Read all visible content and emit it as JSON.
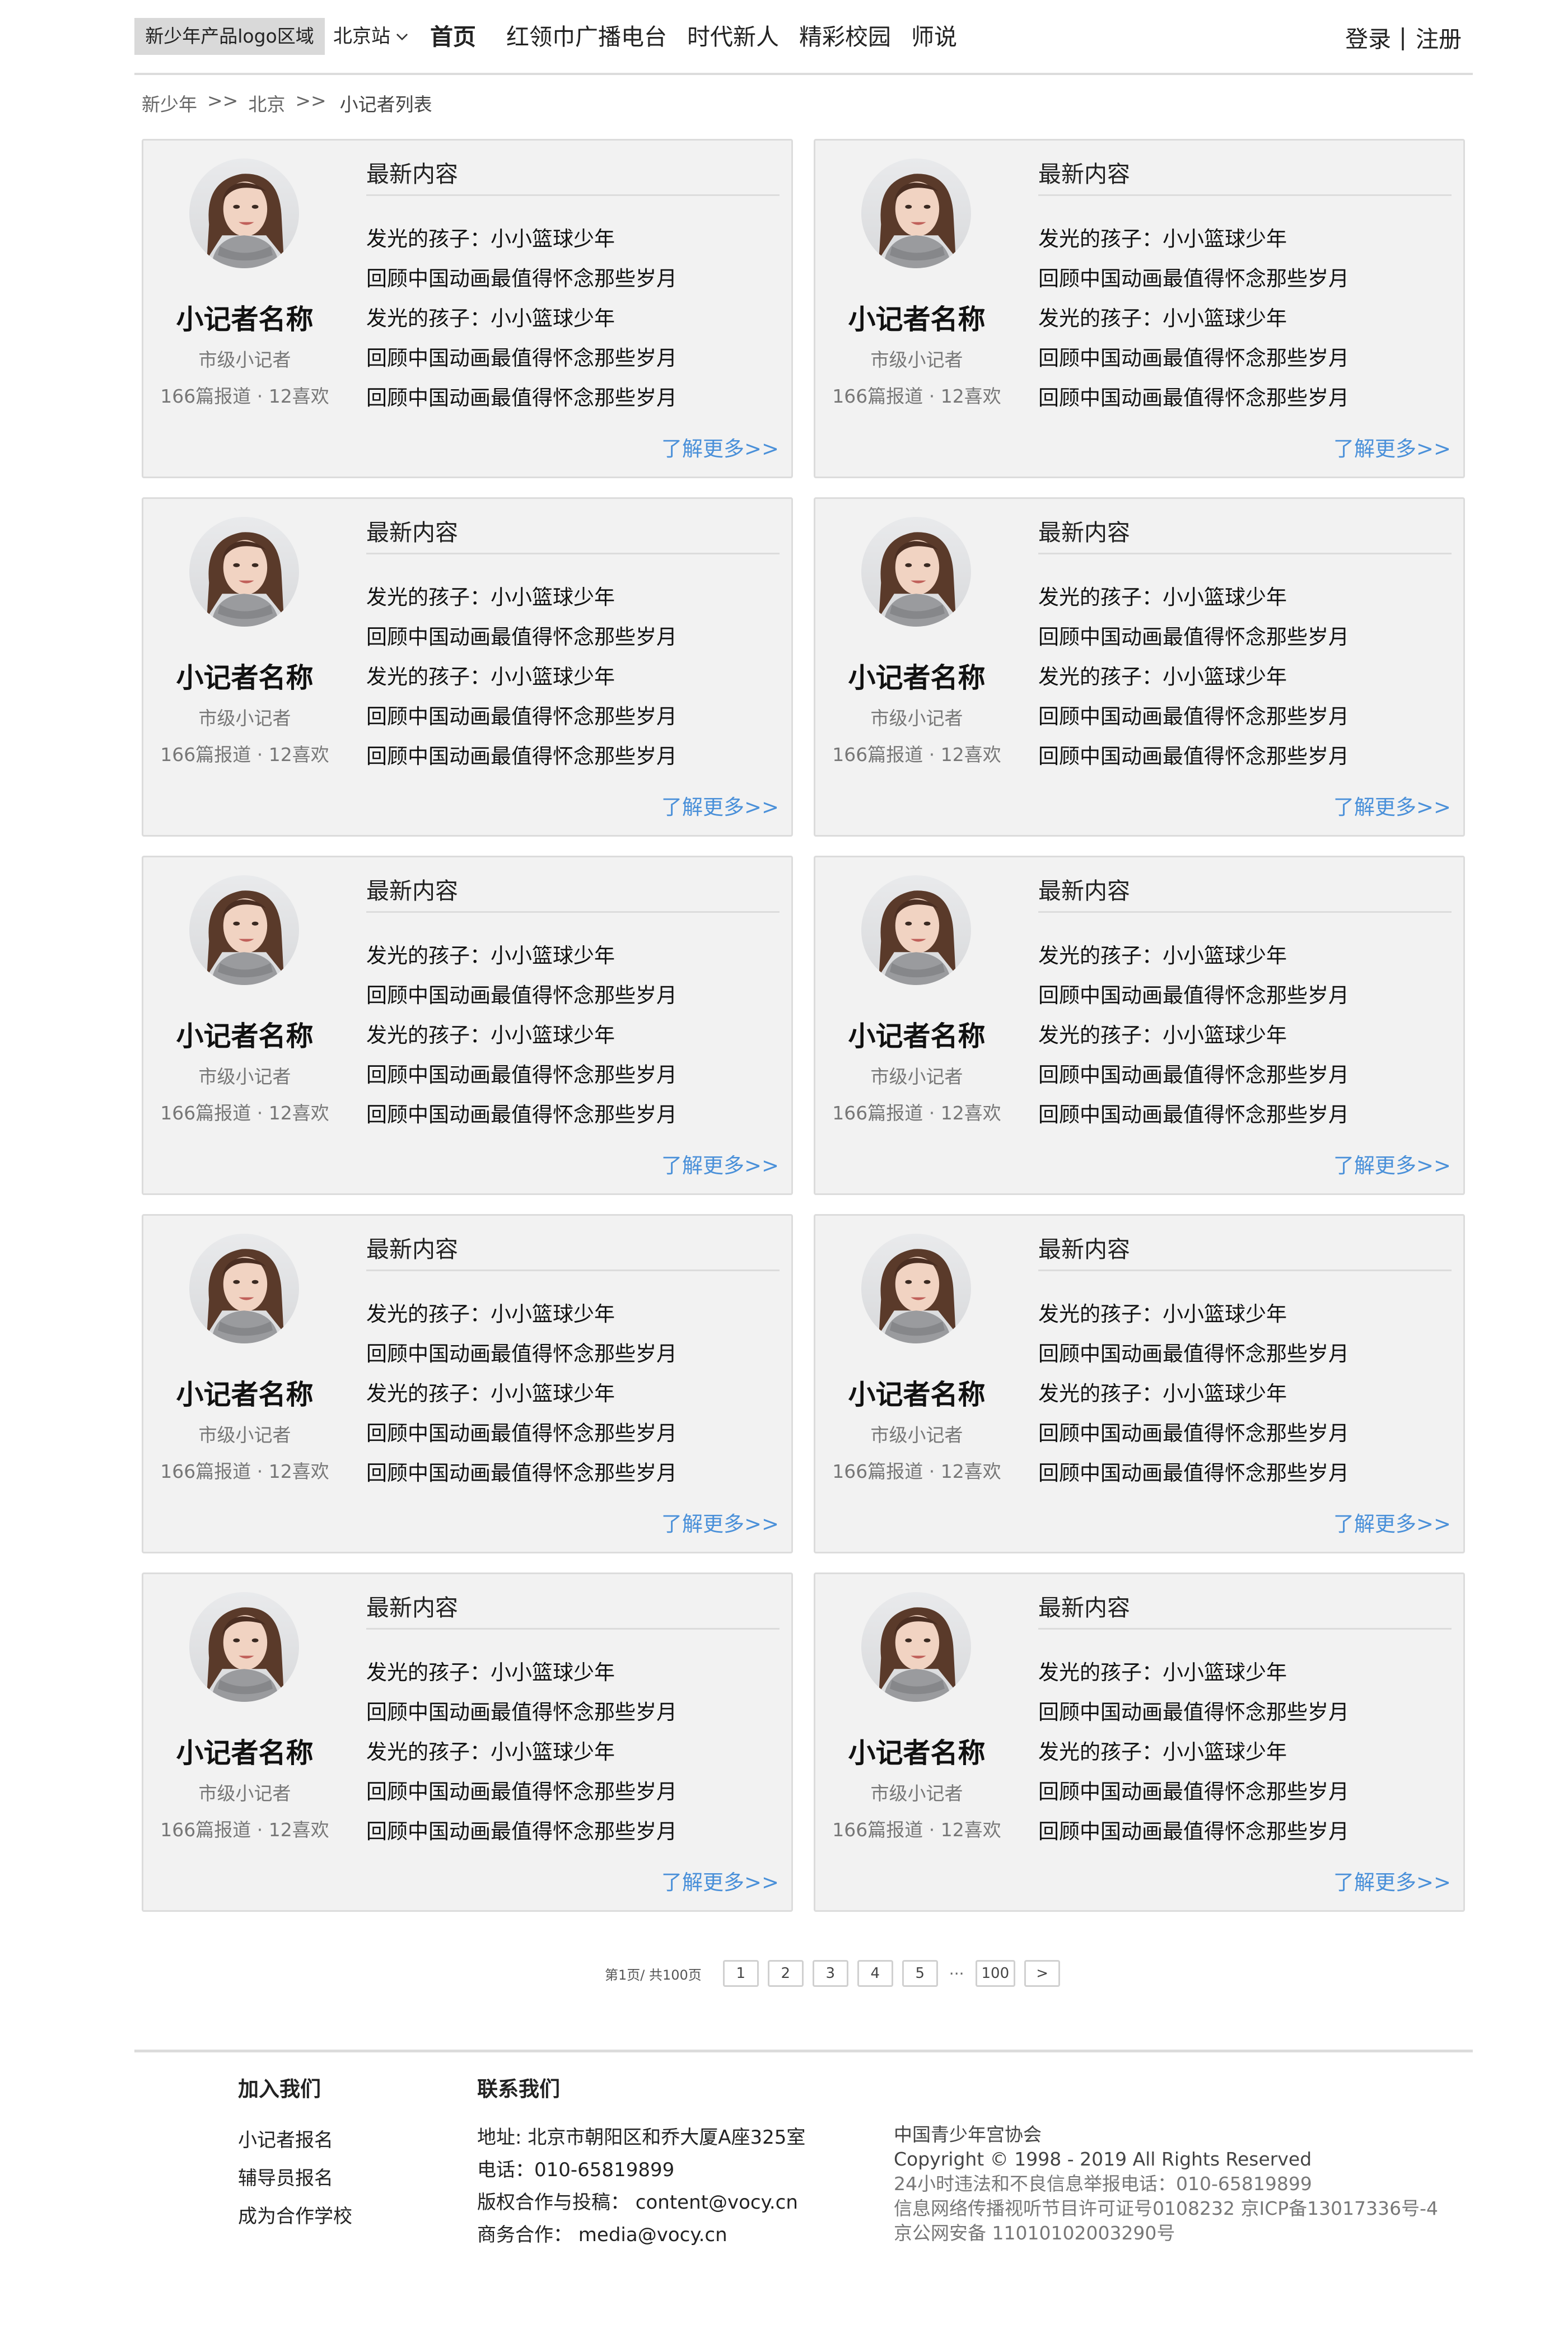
{
  "header": {
    "logo_text": "新少年产品logo区域",
    "city": "北京站",
    "nav": [
      {
        "label": "首页",
        "active": true
      },
      {
        "label": "红领巾广播电台",
        "active": false
      },
      {
        "label": "时代新人",
        "active": false
      },
      {
        "label": "精彩校园",
        "active": false
      },
      {
        "label": "师说",
        "active": false
      }
    ],
    "login": "登录",
    "divider": "|",
    "register": "注册"
  },
  "breadcrumb": {
    "items": [
      "新少年",
      "北京",
      "小记者列表"
    ],
    "separator": ">>"
  },
  "cards": [
    {
      "name": "小记者名称",
      "level": "市级小记者",
      "stats": "166篇报道 · 12喜欢",
      "latest_title": "最新内容",
      "items": [
        "发光的孩子：小小篮球少年",
        "回顾中国动画最值得怀念那些岁月",
        "发光的孩子：小小篮球少年",
        "回顾中国动画最值得怀念那些岁月",
        "回顾中国动画最值得怀念那些岁月"
      ],
      "more": "了解更多>>"
    },
    {
      "name": "小记者名称",
      "level": "市级小记者",
      "stats": "166篇报道 · 12喜欢",
      "latest_title": "最新内容",
      "items": [
        "发光的孩子：小小篮球少年",
        "回顾中国动画最值得怀念那些岁月",
        "发光的孩子：小小篮球少年",
        "回顾中国动画最值得怀念那些岁月",
        "回顾中国动画最值得怀念那些岁月"
      ],
      "more": "了解更多>>"
    },
    {
      "name": "小记者名称",
      "level": "市级小记者",
      "stats": "166篇报道 · 12喜欢",
      "latest_title": "最新内容",
      "items": [
        "发光的孩子：小小篮球少年",
        "回顾中国动画最值得怀念那些岁月",
        "发光的孩子：小小篮球少年",
        "回顾中国动画最值得怀念那些岁月",
        "回顾中国动画最值得怀念那些岁月"
      ],
      "more": "了解更多>>"
    },
    {
      "name": "小记者名称",
      "level": "市级小记者",
      "stats": "166篇报道 · 12喜欢",
      "latest_title": "最新内容",
      "items": [
        "发光的孩子：小小篮球少年",
        "回顾中国动画最值得怀念那些岁月",
        "发光的孩子：小小篮球少年",
        "回顾中国动画最值得怀念那些岁月",
        "回顾中国动画最值得怀念那些岁月"
      ],
      "more": "了解更多>>"
    },
    {
      "name": "小记者名称",
      "level": "市级小记者",
      "stats": "166篇报道 · 12喜欢",
      "latest_title": "最新内容",
      "items": [
        "发光的孩子：小小篮球少年",
        "回顾中国动画最值得怀念那些岁月",
        "发光的孩子：小小篮球少年",
        "回顾中国动画最值得怀念那些岁月",
        "回顾中国动画最值得怀念那些岁月"
      ],
      "more": "了解更多>>"
    },
    {
      "name": "小记者名称",
      "level": "市级小记者",
      "stats": "166篇报道 · 12喜欢",
      "latest_title": "最新内容",
      "items": [
        "发光的孩子：小小篮球少年",
        "回顾中国动画最值得怀念那些岁月",
        "发光的孩子：小小篮球少年",
        "回顾中国动画最值得怀念那些岁月",
        "回顾中国动画最值得怀念那些岁月"
      ],
      "more": "了解更多>>"
    },
    {
      "name": "小记者名称",
      "level": "市级小记者",
      "stats": "166篇报道 · 12喜欢",
      "latest_title": "最新内容",
      "items": [
        "发光的孩子：小小篮球少年",
        "回顾中国动画最值得怀念那些岁月",
        "发光的孩子：小小篮球少年",
        "回顾中国动画最值得怀念那些岁月",
        "回顾中国动画最值得怀念那些岁月"
      ],
      "more": "了解更多>>"
    },
    {
      "name": "小记者名称",
      "level": "市级小记者",
      "stats": "166篇报道 · 12喜欢",
      "latest_title": "最新内容",
      "items": [
        "发光的孩子：小小篮球少年",
        "回顾中国动画最值得怀念那些岁月",
        "发光的孩子：小小篮球少年",
        "回顾中国动画最值得怀念那些岁月",
        "回顾中国动画最值得怀念那些岁月"
      ],
      "more": "了解更多>>"
    },
    {
      "name": "小记者名称",
      "level": "市级小记者",
      "stats": "166篇报道 · 12喜欢",
      "latest_title": "最新内容",
      "items": [
        "发光的孩子：小小篮球少年",
        "回顾中国动画最值得怀念那些岁月",
        "发光的孩子：小小篮球少年",
        "回顾中国动画最值得怀念那些岁月",
        "回顾中国动画最值得怀念那些岁月"
      ],
      "more": "了解更多>>"
    },
    {
      "name": "小记者名称",
      "level": "市级小记者",
      "stats": "166篇报道 · 12喜欢",
      "latest_title": "最新内容",
      "items": [
        "发光的孩子：小小篮球少年",
        "回顾中国动画最值得怀念那些岁月",
        "发光的孩子：小小篮球少年",
        "回顾中国动画最值得怀念那些岁月",
        "回顾中国动画最值得怀念那些岁月"
      ],
      "more": "了解更多>>"
    }
  ],
  "pagination": {
    "info": "第1页/ 共100页",
    "pages": [
      "1",
      "2",
      "3",
      "4",
      "5"
    ],
    "ellipsis": "···",
    "last": "100",
    "next": ">"
  },
  "footer": {
    "join": {
      "title": "加入我们",
      "links": [
        "小记者报名",
        "辅导员报名",
        "成为合作学校"
      ]
    },
    "contact": {
      "title": "联系我们",
      "lines": [
        "地址: 北京市朝阳区和乔大厦A座325室",
        "电话：010-65819899",
        "版权合作与投稿：  content@vocy.cn",
        "商务合作：  media@vocy.cn"
      ]
    },
    "legal": [
      "中国青少年宫协会",
      "Copyright © 1998 - 2019 All Rights Reserved",
      "24小时违法和不良信息举报电话：010-65819899",
      "信息网络传播视听节目许可证号0108232 京ICP备13017336号-4",
      "京公网安备 11010102003290号"
    ]
  },
  "colors": {
    "link_blue": "#4a90d9",
    "card_bg": "#f2f2f2",
    "border": "#dcdcdc",
    "logo_bg": "#d9d9d9"
  }
}
